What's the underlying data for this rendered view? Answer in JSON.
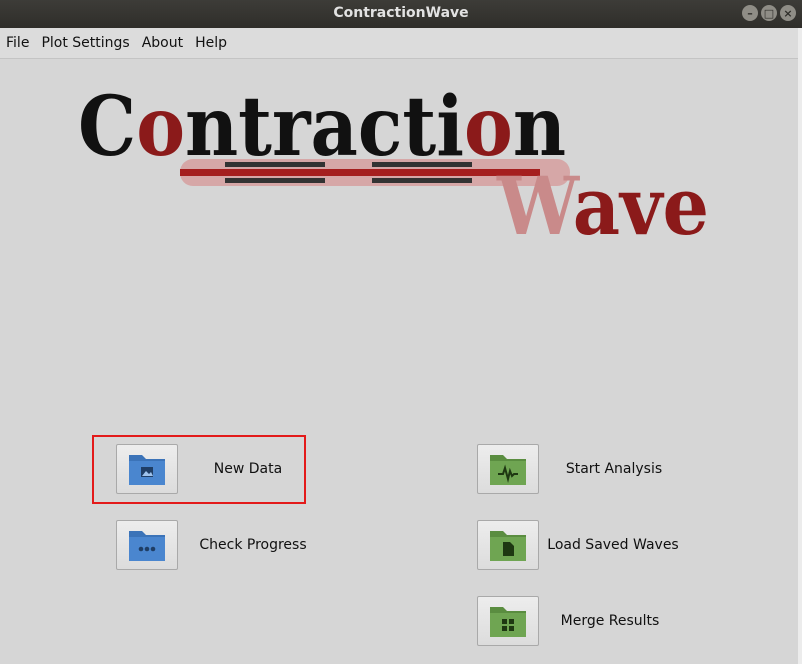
{
  "window": {
    "title": "ContractionWave"
  },
  "window_buttons": {
    "minimize": "–",
    "maximize": "□",
    "close": "×"
  },
  "menu": [
    {
      "label": "File"
    },
    {
      "label": "Plot Settings"
    },
    {
      "label": "About"
    },
    {
      "label": "Help"
    }
  ],
  "logo": {
    "word1": {
      "a": "C",
      "b": "o",
      "c": "ntracti",
      "d": "o",
      "e": "n"
    },
    "word2": {
      "a": "W",
      "b": "ave"
    },
    "colors": {
      "dark": "#111111",
      "red": "#8b1a1a",
      "pink": "#c98a8a"
    }
  },
  "buttons": {
    "new_data": {
      "label": "New Data",
      "icon": "folder-image-icon",
      "color": "#4a86cf"
    },
    "check_progress": {
      "label": "Check Progress",
      "icon": "folder-dots-icon",
      "color": "#4a86cf"
    },
    "start_analysis": {
      "label": "Start Analysis",
      "icon": "folder-waveform-icon",
      "color": "#6fa552"
    },
    "load_saved_waves": {
      "label": "Load Saved Waves",
      "icon": "folder-file-icon",
      "color": "#6fa552"
    },
    "merge_results": {
      "label": "Merge Results",
      "icon": "folder-grid-icon",
      "color": "#6fa552"
    }
  }
}
